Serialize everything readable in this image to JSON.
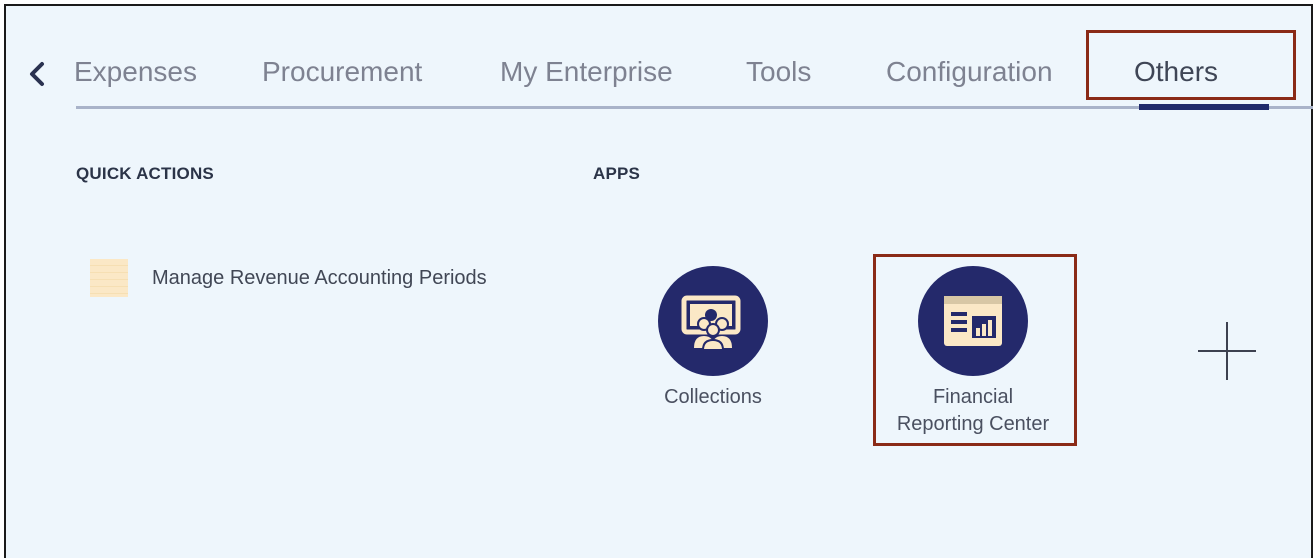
{
  "nav": {
    "tabs": [
      {
        "label": "Expenses"
      },
      {
        "label": "Procurement"
      },
      {
        "label": "My Enterprise"
      },
      {
        "label": "Tools"
      },
      {
        "label": "Configuration"
      },
      {
        "label": "Others",
        "active": true
      }
    ]
  },
  "quick_actions": {
    "title": "QUICK ACTIONS",
    "items": [
      {
        "label": "Manage Revenue Accounting Periods"
      }
    ]
  },
  "apps": {
    "title": "APPS",
    "items": [
      {
        "label": "Collections",
        "icon": "collections-icon"
      },
      {
        "label_line1": "Financial",
        "label_line2": "Reporting Center",
        "icon": "financial-reporting-icon"
      }
    ]
  },
  "colors": {
    "background": "#eef6fc",
    "app_circle": "#24296b",
    "active_tab_underline": "#202a6b",
    "highlight_border": "#8a2a17"
  }
}
